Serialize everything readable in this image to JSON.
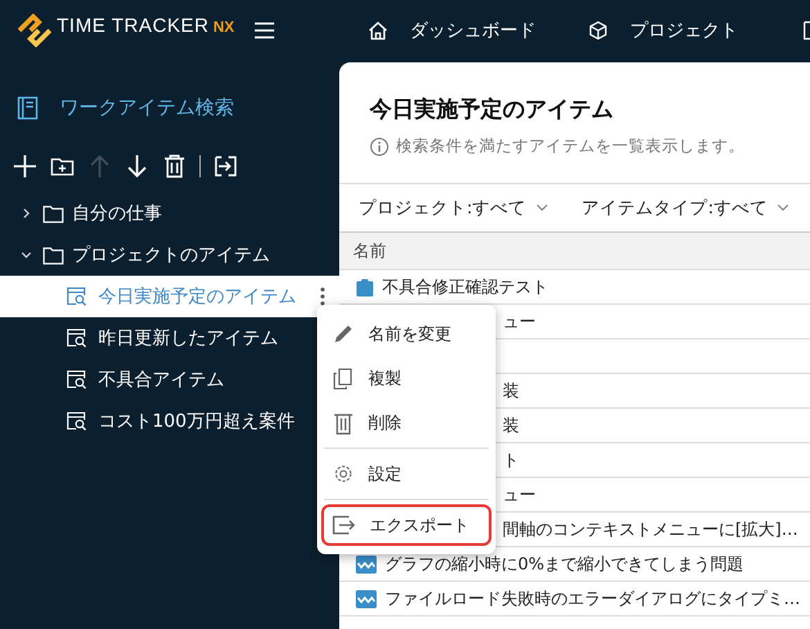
{
  "logo": {
    "name": "TIME TRACKER",
    "suffix": "NX"
  },
  "nav": [
    {
      "label": "ダッシュボード",
      "kind": "home"
    },
    {
      "label": "プロジェクト",
      "kind": "cube"
    }
  ],
  "sidebar": {
    "title": "ワークアイテム検索",
    "toolbar": [
      {
        "kind": "add",
        "disabled": false
      },
      {
        "kind": "folder",
        "disabled": false
      },
      {
        "kind": "up",
        "disabled": true
      },
      {
        "kind": "down",
        "disabled": false
      },
      {
        "kind": "trash",
        "disabled": false
      },
      {
        "kind": "export",
        "disabled": false
      }
    ],
    "tree": [
      {
        "label": "自分の仕事",
        "expanded": false
      },
      {
        "label": "プロジェクトのアイテム",
        "expanded": true,
        "children": [
          {
            "label": "今日実施予定のアイテム",
            "selected": true
          },
          {
            "label": "昨日更新したアイテム",
            "selected": false
          },
          {
            "label": "不具合アイテム",
            "selected": false
          },
          {
            "label": "コスト100万円超え案件",
            "selected": false
          }
        ]
      }
    ]
  },
  "panel": {
    "title": "今日実施予定のアイテム",
    "info": "検索条件を満たすアイテムを一覧表示します。",
    "filters": [
      "プロジェクト:すべて",
      "アイテムタイプ:すべて"
    ],
    "table": {
      "columns": [
        "名前"
      ],
      "rows": [
        {
          "kind": "task",
          "name": "不具合修正確認テスト"
        },
        {
          "kind": "covered",
          "name": "ュー"
        },
        {
          "kind": "covered"
        },
        {
          "kind": "covered",
          "name": "装"
        },
        {
          "kind": "covered",
          "name": "装"
        },
        {
          "kind": "covered",
          "name": "ト"
        },
        {
          "kind": "covered",
          "name": "ュー"
        },
        {
          "kind": "covered",
          "name": "間軸のコンテキストメニューに[拡大]…"
        },
        {
          "kind": "issue",
          "name": "グラフの縮小時に0%まで縮小できてしまう問題"
        },
        {
          "kind": "issue",
          "name": "ファイルロード失敗時のエラーダイアログにタイプミ…"
        }
      ]
    }
  },
  "context_menu": [
    {
      "kind": "rename",
      "label": "名前を変更",
      "selected": false
    },
    {
      "kind": "copy",
      "label": "複製",
      "selected": false
    },
    {
      "kind": "delete",
      "label": "削除",
      "selected": false
    },
    {
      "kind": "settings",
      "label": "設定",
      "selected": false
    },
    {
      "kind": "export",
      "label": "エクスポート",
      "selected": true
    }
  ]
}
